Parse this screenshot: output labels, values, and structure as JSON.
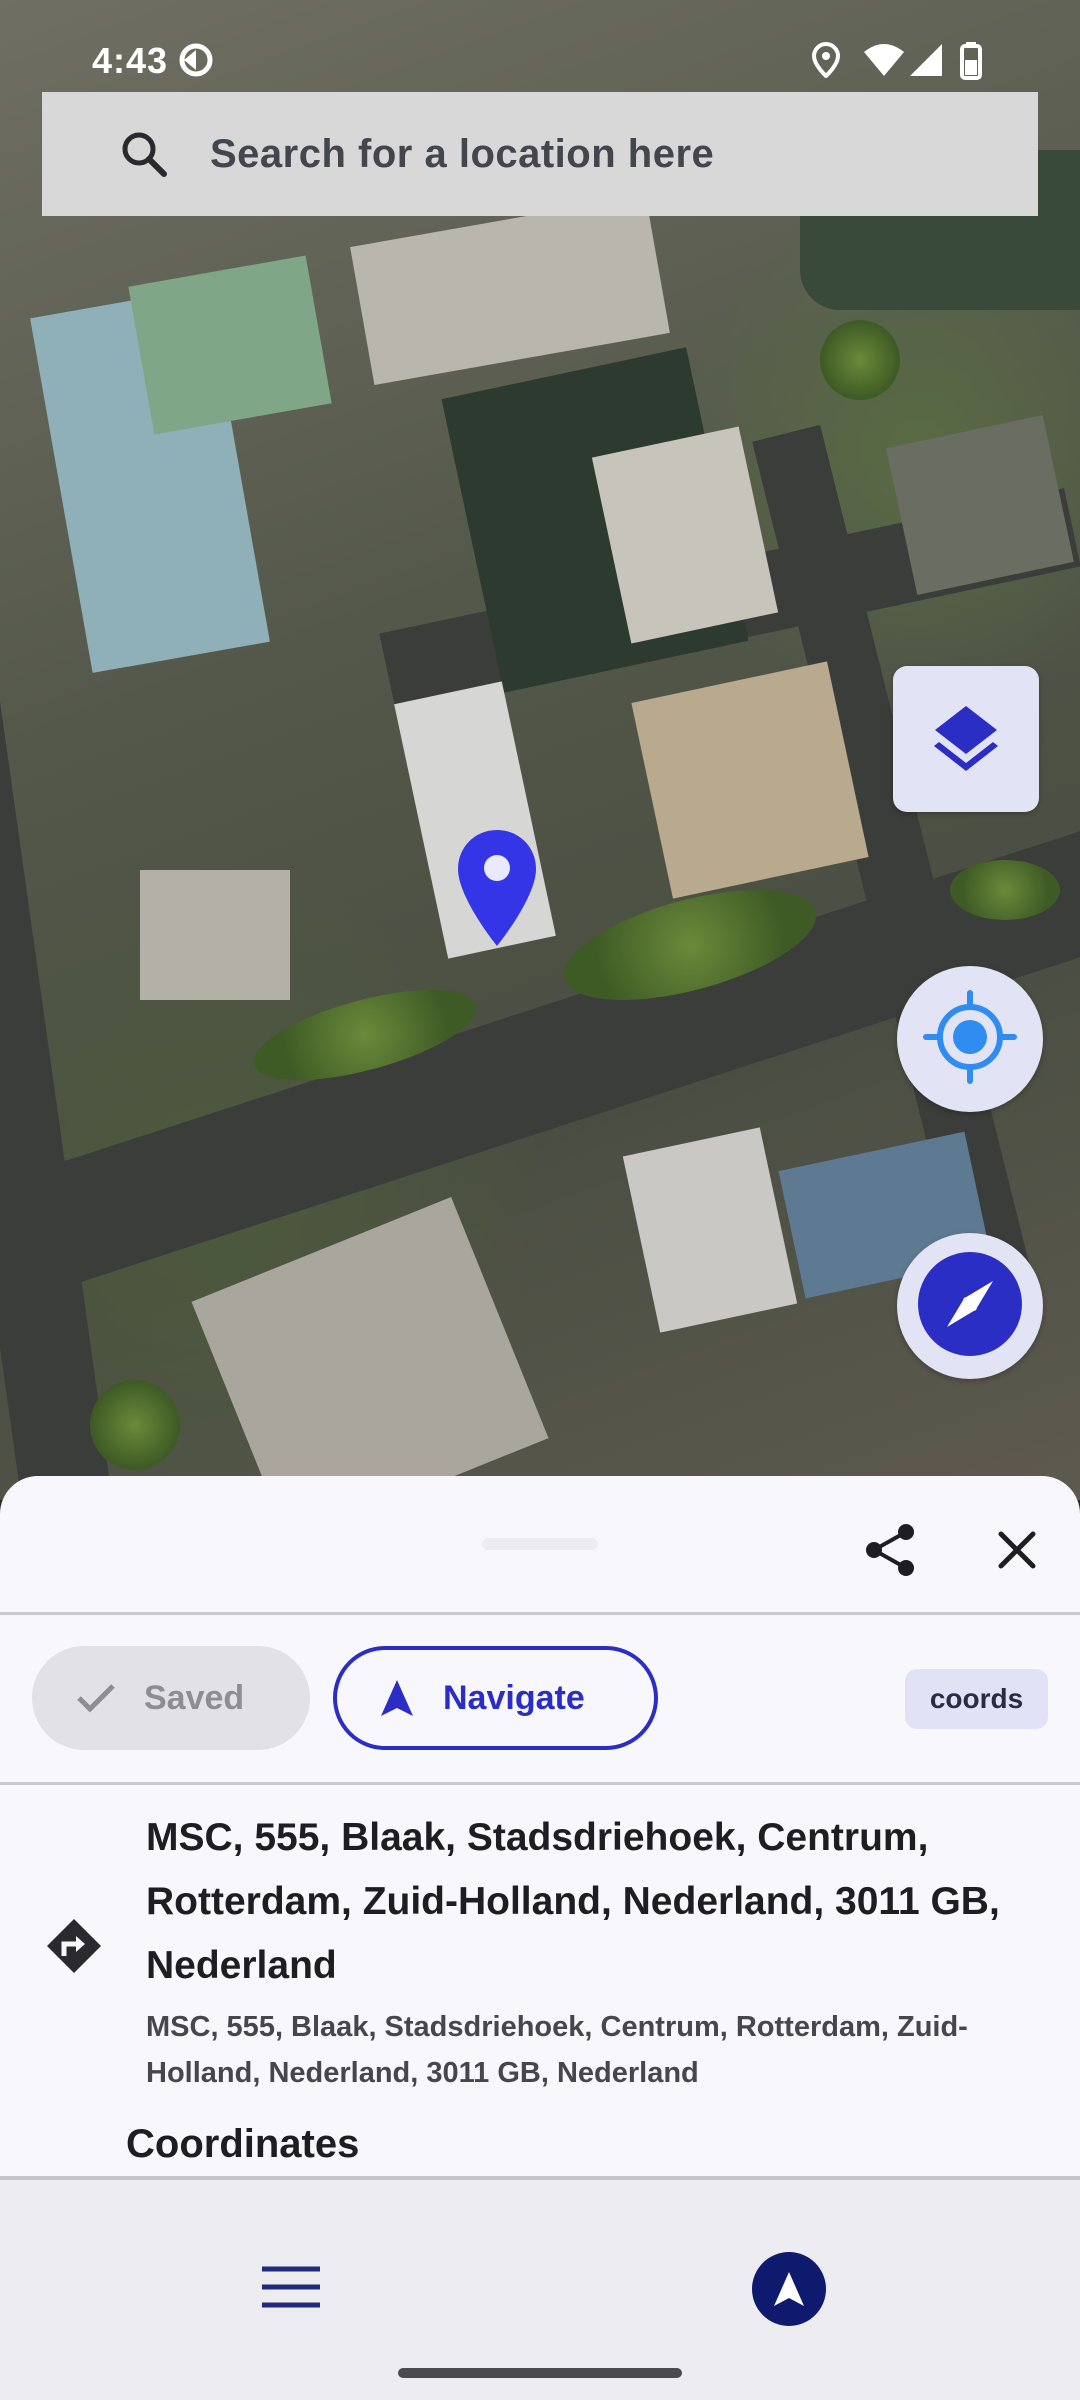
{
  "status_bar": {
    "time": "4:43"
  },
  "search": {
    "placeholder": "Search for a location here",
    "icon": "search-icon"
  },
  "map": {
    "type": "satellite",
    "buttons": {
      "layers": "layers-icon",
      "my_location": "my-location-icon",
      "compass": "compass-icon"
    },
    "accent_color": "#2b2ec4",
    "pin_color": "#3535e8"
  },
  "sheet": {
    "actions": {
      "saved_label": "Saved",
      "navigate_label": "Navigate",
      "coords_label": "coords"
    },
    "place": {
      "title": "MSC, 555, Blaak, Stadsdriehoek, Centrum, Rotterdam, Zuid-Holland, Nederland, 3011 GB, Nederland",
      "subtitle": "MSC, 555, Blaak, Stadsdriehoek, Centrum, Rotterdam, Zuid-Holland, Nederland, 3011 GB, Nederland"
    },
    "section_heading": "Coordinates"
  },
  "bottom_nav": {
    "menu_icon": "menu-icon",
    "navigation_icon": "navigation-arrow-icon"
  }
}
